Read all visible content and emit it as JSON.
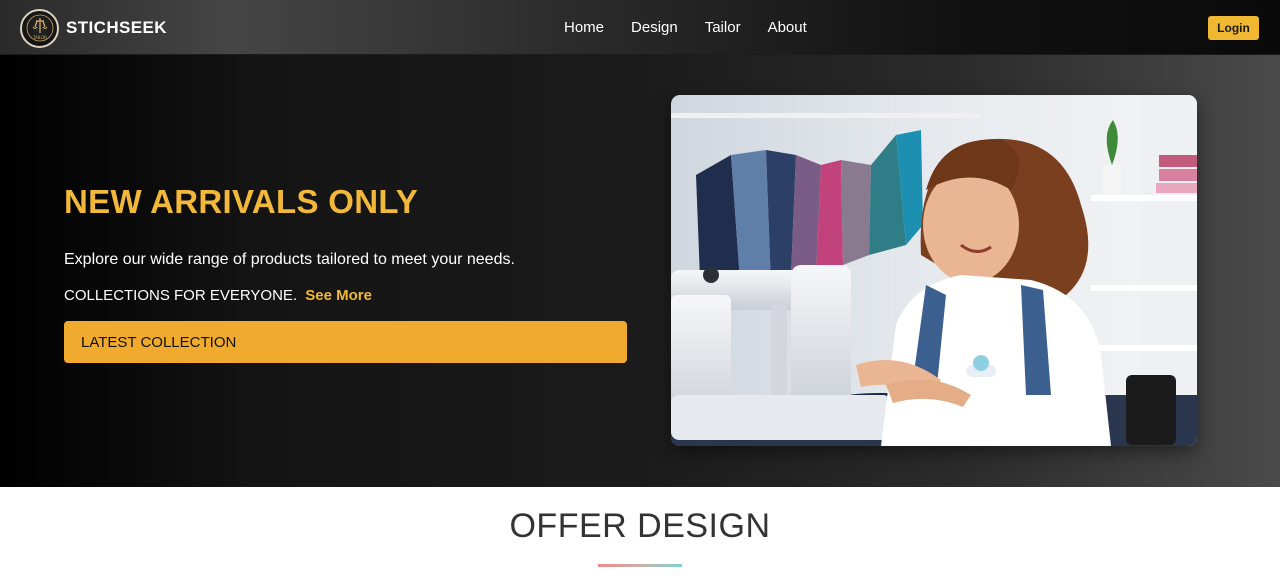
{
  "nav": {
    "brand": "STICHSEEK",
    "logo_text": "TAILOR",
    "links": [
      "Home",
      "Design",
      "Tailor",
      "About"
    ],
    "login_label": "Login"
  },
  "hero": {
    "title": "NEW ARRIVALS ONLY",
    "description": "Explore our wide range of products tailored to meet your needs.",
    "collections_text": "COLLECTIONS FOR EVERYONE.",
    "see_more_label": "See More",
    "cta_label": "LATEST COLLECTION",
    "image_icon": "photo-woman-sewing-machine"
  },
  "offer": {
    "title": "OFFER DESIGN"
  },
  "colors": {
    "accent": "#f1b83a",
    "button": "#f0ab2f"
  }
}
